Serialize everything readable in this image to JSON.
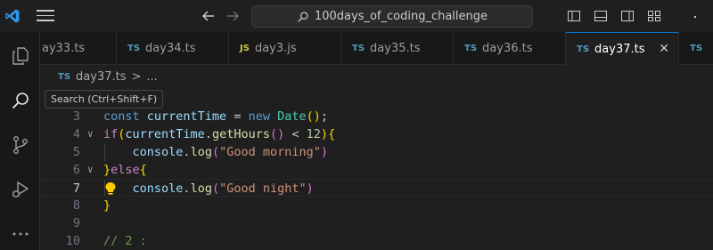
{
  "window": {
    "search_text": "100days_of_coding_challenge"
  },
  "tabs": [
    {
      "badge": "TS",
      "label": "ay33.ts"
    },
    {
      "badge": "TS",
      "label": "day34.ts"
    },
    {
      "badge": "JS",
      "label": "day3.js"
    },
    {
      "badge": "TS",
      "label": "day35.ts"
    },
    {
      "badge": "TS",
      "label": "day36.ts"
    },
    {
      "badge": "TS",
      "label": "day37.ts",
      "active": true,
      "close": "✕"
    },
    {
      "badge": "TS",
      "label": ""
    }
  ],
  "breadcrumb": {
    "badge": "TS",
    "file": "day37.ts",
    "sep": ">",
    "rest": "..."
  },
  "tooltip": {
    "text": "Search (Ctrl+Shift+F)"
  },
  "editor": {
    "current_line": 7,
    "lines": [
      {
        "num": "3",
        "parts": [
          [
            "kw",
            "const"
          ],
          [
            "plain",
            " "
          ],
          [
            "var",
            "currentTime"
          ],
          [
            "plain",
            " = "
          ],
          [
            "kw",
            "new"
          ],
          [
            "plain",
            " "
          ],
          [
            "cls",
            "Date"
          ],
          [
            "brace",
            "()"
          ],
          [
            "plain",
            ";"
          ]
        ]
      },
      {
        "num": "4",
        "fold": "∨",
        "parts": [
          [
            "kw2",
            "if"
          ],
          [
            "brace",
            "("
          ],
          [
            "var",
            "currentTime"
          ],
          [
            "plain",
            "."
          ],
          [
            "fn",
            "getHours"
          ],
          [
            "paren",
            "()"
          ],
          [
            "plain",
            " < "
          ],
          [
            "num",
            "12"
          ],
          [
            "brace",
            ")"
          ],
          [
            "brace",
            "{"
          ]
        ]
      },
      {
        "num": "5",
        "parts": [
          [
            "plain",
            "    "
          ],
          [
            "var",
            "console"
          ],
          [
            "plain",
            "."
          ],
          [
            "fn",
            "log"
          ],
          [
            "paren",
            "("
          ],
          [
            "str",
            "\"Good morning\""
          ],
          [
            "paren",
            ")"
          ]
        ]
      },
      {
        "num": "6",
        "fold": "∨",
        "parts": [
          [
            "brace",
            "}"
          ],
          [
            "kw2",
            "else"
          ],
          [
            "brace",
            "{"
          ]
        ]
      },
      {
        "num": "7",
        "parts": [
          [
            "plain",
            "    "
          ],
          [
            "var",
            "console"
          ],
          [
            "plain",
            "."
          ],
          [
            "fn",
            "log"
          ],
          [
            "paren",
            "("
          ],
          [
            "str",
            "\"Good night\""
          ],
          [
            "paren",
            ")"
          ]
        ]
      },
      {
        "num": "8",
        "parts": [
          [
            "brace",
            "}"
          ]
        ]
      },
      {
        "num": "9",
        "parts": []
      },
      {
        "num": "10",
        "parts": [
          [
            "cmt",
            "// 2 :"
          ]
        ]
      }
    ]
  },
  "icons": {
    "logo": "vscode-logo-icon",
    "menu": "hamburger-menu-icon",
    "back": "arrow-left-icon",
    "forward": "arrow-right-icon",
    "search": "search-icon",
    "explorer": "files-icon",
    "scm": "source-control-icon",
    "debug": "run-debug-icon",
    "more": "more-icon",
    "lightbulb": "lightbulb-icon"
  },
  "colors": {
    "accent": "#0078d4",
    "ts_badge": "#519aba",
    "js_badge": "#cbcb41"
  }
}
